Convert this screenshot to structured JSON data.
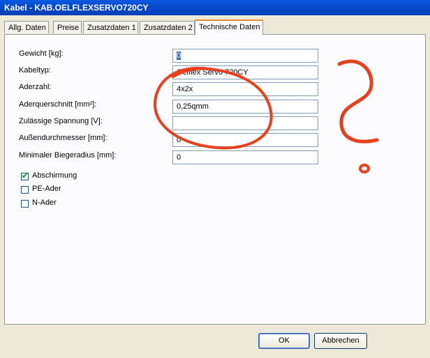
{
  "window": {
    "title": "Kabel - KAB.OELFLEXSERVO720CY"
  },
  "tabs": [
    {
      "label": "Allg. Daten"
    },
    {
      "label": "Preise"
    },
    {
      "label": "Zusatzdaten 1"
    },
    {
      "label": "Zusatzdaten 2"
    },
    {
      "label": "Technische Daten"
    }
  ],
  "fields": {
    "gewicht": {
      "label": "Gewicht [kg]:",
      "value": "0"
    },
    "kabeltyp": {
      "label": "Kabeltyp:",
      "value": "Oelflex Servo 720CY"
    },
    "aderzahl": {
      "label": "Aderzahl:",
      "value": "4x2x"
    },
    "aderquerschnitt": {
      "label": "Aderquerschnitt [mm²]:",
      "value": "0,25qmm"
    },
    "spannung": {
      "label": "Zulässige Spannung [V]:",
      "value": ""
    },
    "aussendurchmesser": {
      "label": "Außendurchmesser [mm]:",
      "value": "0"
    },
    "biegeradius": {
      "label": "Minimaler Biegeradius [mm]:",
      "value": "0"
    }
  },
  "checkboxes": [
    {
      "label": "Abschirmung",
      "checked": true
    },
    {
      "label": "PE-Ader",
      "checked": false
    },
    {
      "label": "N-Ader",
      "checked": false
    }
  ],
  "buttons": {
    "ok": "OK",
    "cancel": "Abbrechen"
  },
  "annotation": {
    "symbol": "question-mark",
    "color": "#e8401c"
  }
}
